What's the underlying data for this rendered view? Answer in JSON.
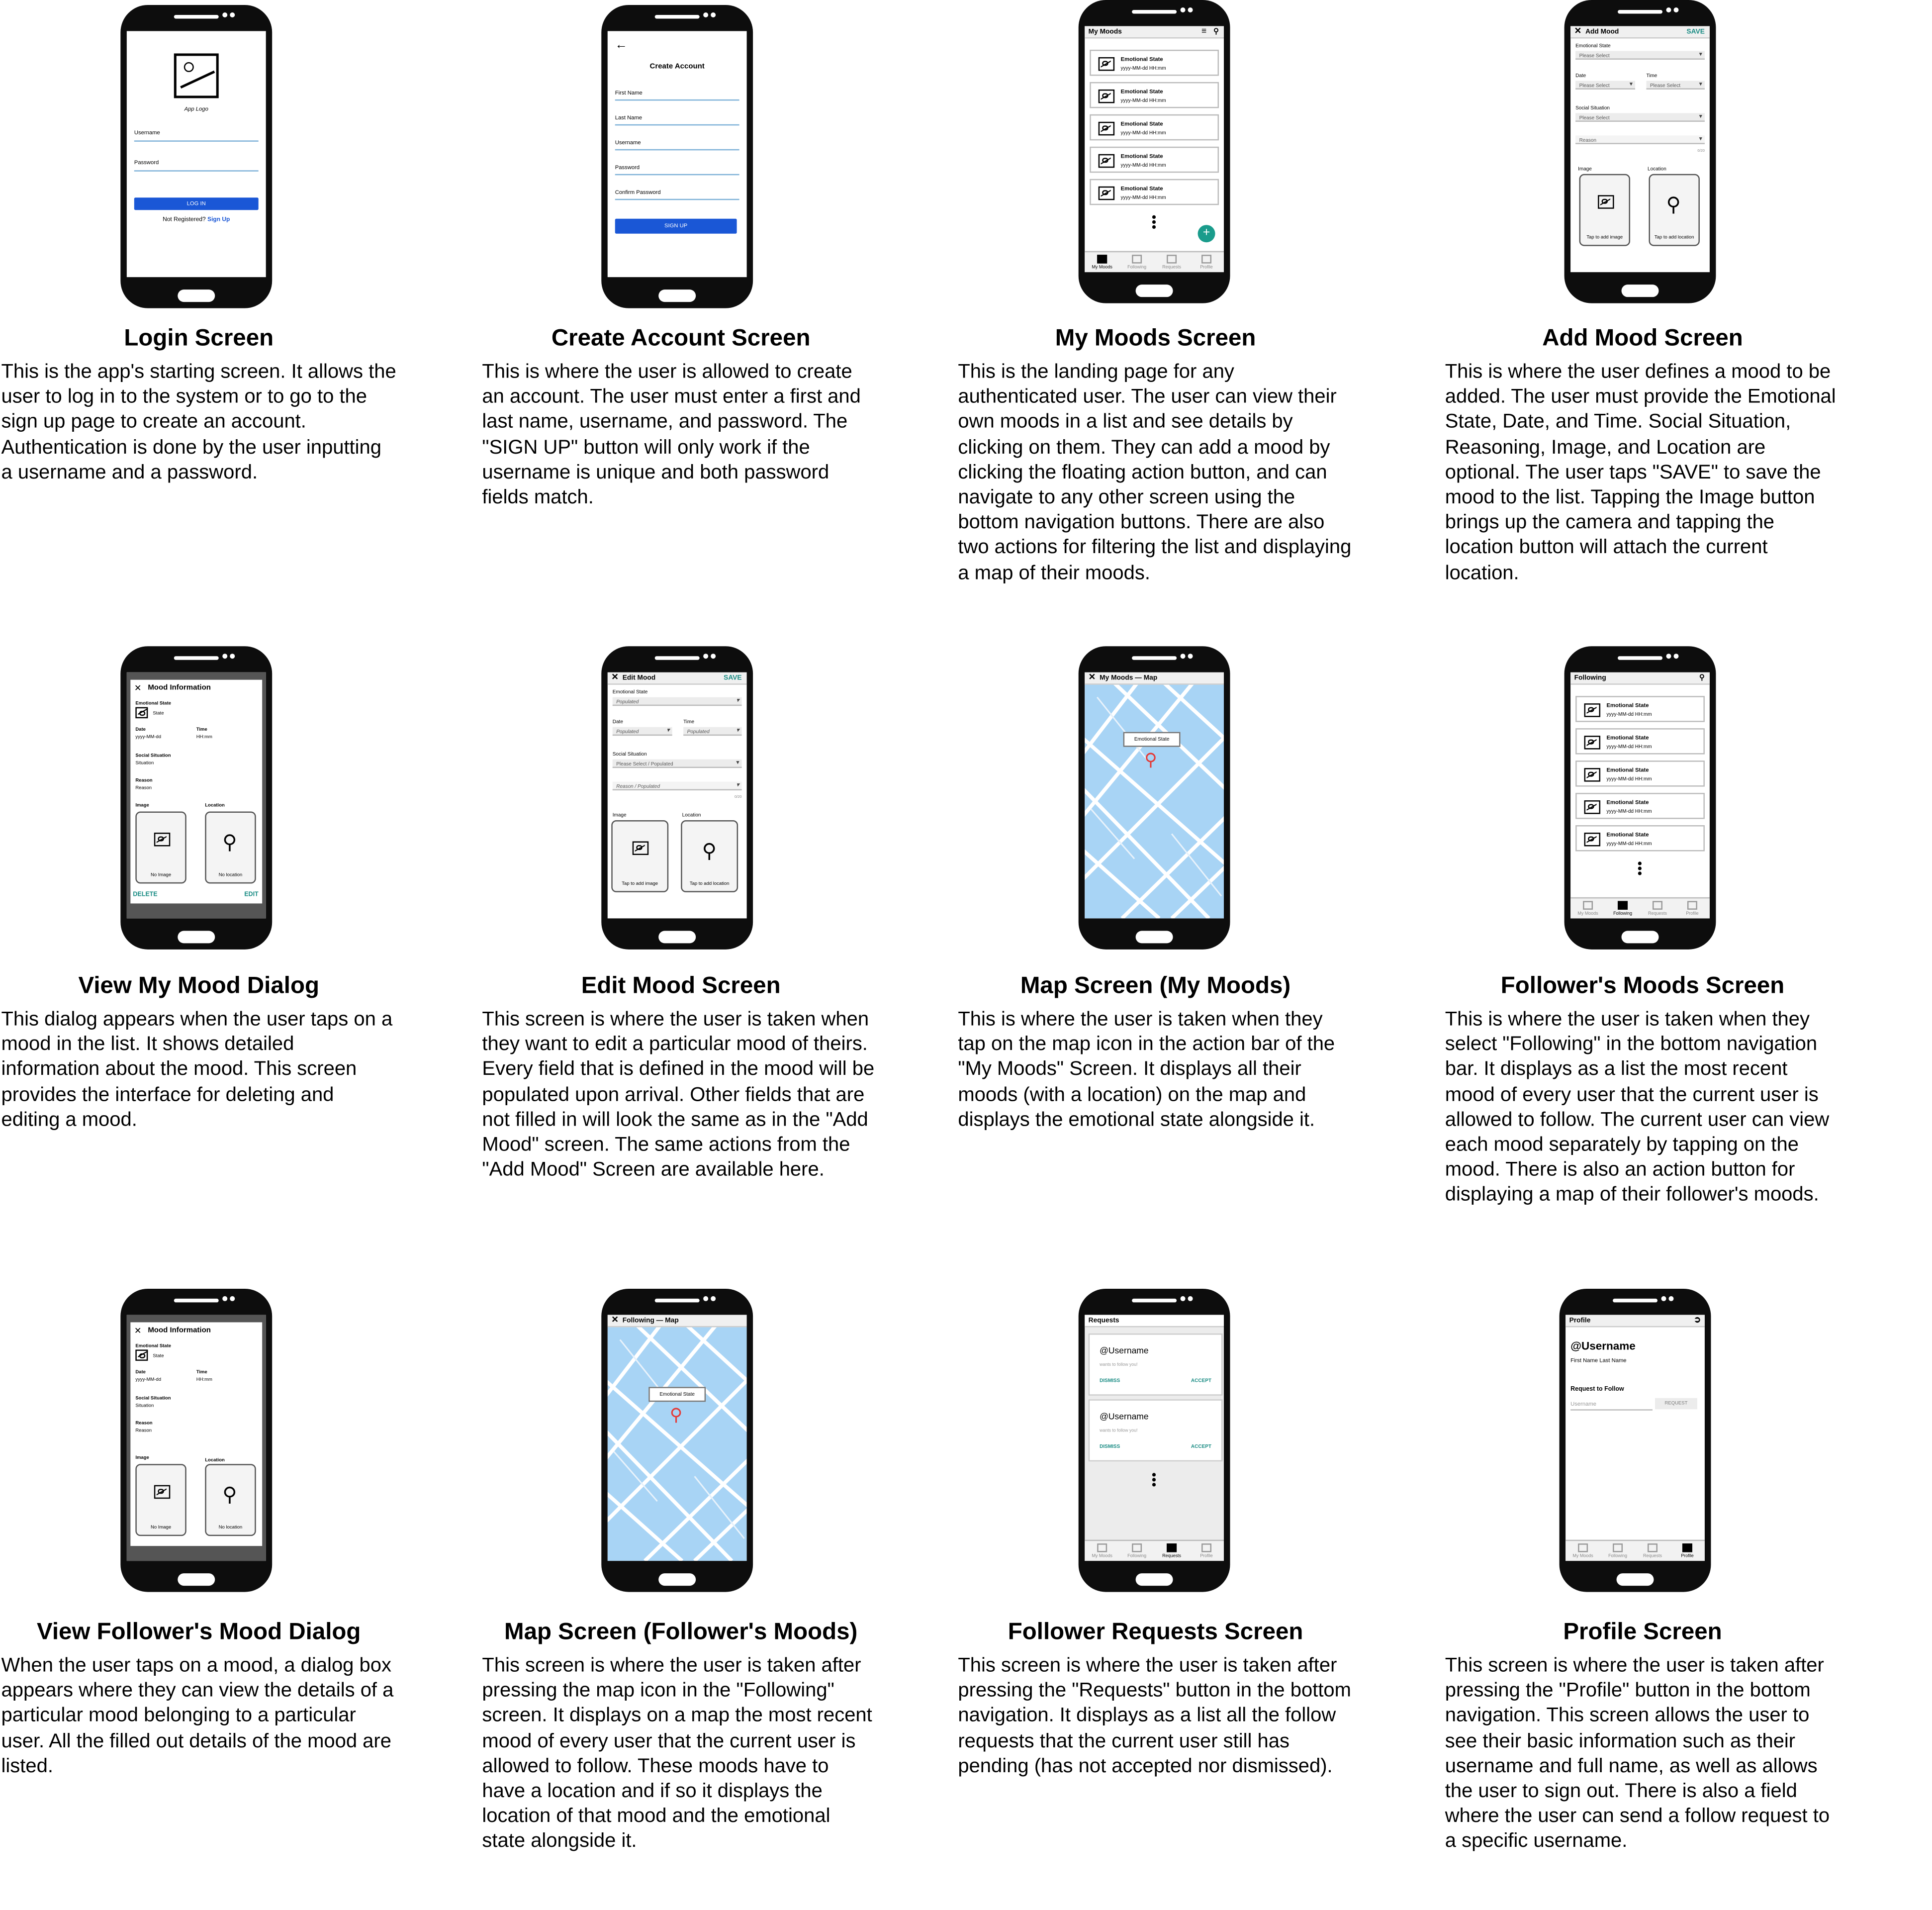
{
  "screens": [
    {
      "id": "login",
      "title": "Login Screen",
      "description": "This is the app's starting screen. It allows the user to log in to the system or to go to the sign up page to create an account. Authentication is done by the user inputting a username and a password.",
      "ui": {
        "logo_label": "App Logo",
        "username_label": "Username",
        "password_label": "Password",
        "login_button": "LOG IN",
        "not_registered": "Not Registered?",
        "signup_link": "Sign Up"
      }
    },
    {
      "id": "create-account",
      "title": "Create Account Screen",
      "description": "This is where the user is allowed to create an account. The user must enter a first and last name, username, and password. The \"SIGN UP\" button will only work if the username is unique and both password fields match.",
      "ui": {
        "heading": "Create Account",
        "first_name": "First Name",
        "last_name": "Last Name",
        "username": "Username",
        "password": "Password",
        "confirm_password": "Confirm Password",
        "signup_button": "SIGN UP"
      }
    },
    {
      "id": "my-moods",
      "title": "My Moods Screen",
      "description": "This is the landing page for any authenticated user. The user can view their own moods in a list and see details by clicking on them. They can add a mood by clicking the floating action button, and can navigate to any other screen using the bottom navigation buttons. There are also two actions for filtering the list and displaying a map of their moods.",
      "ui": {
        "bar_title": "My Moods",
        "item_title": "Emotional State",
        "item_sub": "yyyy-MM-dd   HH:mm",
        "fab": "+"
      }
    },
    {
      "id": "add-mood",
      "title": "Add Mood Screen",
      "description": "This is where the user defines a mood to be added. The user must provide the Emotional State, Date, and Time. Social Situation, Reasoning, Image, and Location are optional. The user taps \"SAVE\" to save the mood to the list. Tapping the Image button brings up the camera and tapping the location button will attach the current location.",
      "ui": {
        "bar_title": "Add Mood",
        "save": "SAVE",
        "emotional_state": "Emotional State",
        "please_select": "Please Select",
        "date": "Date",
        "time": "Time",
        "social_situation": "Social Situation",
        "reason": "Reason",
        "counter": "0/20",
        "image": "Image",
        "location": "Location",
        "tap_image": "Tap to add image",
        "tap_location": "Tap to add location"
      }
    },
    {
      "id": "view-my-mood",
      "title": "View My Mood Dialog",
      "description": "This dialog appears when the user taps on a mood in the list. It shows detailed information about the mood. This screen provides the interface for deleting and editing a mood.",
      "ui": {
        "dialog_title": "Mood Information",
        "emotional_state": "Emotional State",
        "state": "State",
        "date": "Date",
        "date_val": "yyyy-MM-dd",
        "time": "Time",
        "time_val": "HH:mm",
        "social_situation": "Social Situation",
        "situation": "Situation",
        "reason": "Reason",
        "reason_val": "Reason",
        "image": "Image",
        "location": "Location",
        "no_image": "No Image",
        "no_location": "No location",
        "delete": "DELETE",
        "edit": "EDIT"
      }
    },
    {
      "id": "edit-mood",
      "title": "Edit Mood Screen",
      "description": "This screen is where the user is taken when they want to edit a particular mood of theirs. Every field that is defined in the mood will be populated upon arrival. Other fields that are not filled in will look the same as in the \"Add Mood\" screen. The same actions from the \"Add Mood\" Screen are available here.",
      "ui": {
        "bar_title": "Edit Mood",
        "save": "SAVE",
        "emotional_state": "Emotional State",
        "populated": "Populated",
        "date": "Date",
        "time": "Time",
        "social_situation": "Social Situation",
        "select_populated": "Please Select / Populated",
        "reason_populated": "Reason / Populated",
        "counter": "0/20",
        "image": "Image",
        "location": "Location",
        "tap_image": "Tap to add image",
        "tap_location": "Tap to add location"
      }
    },
    {
      "id": "map-my-moods",
      "title": "Map Screen (My Moods)",
      "description": "This is where the user is taken when they tap on the map icon in the action bar of the \"My Moods\" Screen. It displays all their moods (with a location) on the map and displays the emotional state alongside it.",
      "ui": {
        "bar_title": "My Moods — Map",
        "callout": "Emotional State"
      }
    },
    {
      "id": "followers-moods",
      "title": "Follower's Moods Screen",
      "description": "This is where the user is taken when they select \"Following\" in the bottom navigation bar. It displays as a list the most recent mood of every user that the current user is allowed to follow. The current user can view each mood separately by tapping on the mood. There is also an action button for displaying a map of their follower's moods.",
      "ui": {
        "bar_title": "Following",
        "item_title": "Emotional State",
        "item_sub": "yyyy-MM-dd   HH:mm"
      }
    },
    {
      "id": "view-follower-mood",
      "title": "View Follower's Mood Dialog",
      "description": "When the user taps on a mood, a dialog box appears where they can view the details of a particular mood belonging to a particular user. All the filled out details of the mood are listed.",
      "ui": {
        "dialog_title": "Mood Information",
        "emotional_state": "Emotional State",
        "state": "State",
        "date": "Date",
        "date_val": "yyyy-MM-dd",
        "time": "Time",
        "time_val": "HH:mm",
        "social_situation": "Social Situation",
        "situation": "Situation",
        "reason": "Reason",
        "reason_val": "Reason",
        "image": "Image",
        "location": "Location",
        "no_image": "No Image",
        "no_location": "No location"
      }
    },
    {
      "id": "map-following",
      "title": "Map Screen (Follower's Moods)",
      "description": "This screen is where the user is taken after pressing the map icon in the \"Following\" screen. It displays on a map the most recent mood of every user that the current user is allowed to follow. These moods have to have a location and if so it displays the location of that mood and the emotional state alongside it.",
      "ui": {
        "bar_title": "Following — Map",
        "callout": "Emotional State"
      }
    },
    {
      "id": "requests",
      "title": "Follower Requests Screen",
      "description": "This screen is where the user is taken after pressing the \"Requests\" button in the bottom navigation. It displays as a list all the follow requests that the current user still has pending (has not accepted nor dismissed).",
      "ui": {
        "bar_title": "Requests",
        "username": "@Username",
        "wants": "wants to follow you!",
        "dismiss": "DISMISS",
        "accept": "ACCEPT"
      }
    },
    {
      "id": "profile",
      "title": "Profile Screen",
      "description": "This screen is where the user is taken after pressing the \"Profile\" button in the bottom navigation. This screen allows the user to see their basic information such as their username and full name, as well as allows the user to sign out. There is also a field where the user can send a follow request to a specific username.",
      "ui": {
        "bar_title": "Profile",
        "username": "@Username",
        "full_name": "First Name   Last Name",
        "request_heading": "Request to Follow",
        "username_placeholder": "Username",
        "request_button": "REQUEST"
      }
    }
  ],
  "nav": [
    "My Moods",
    "Following",
    "Requests",
    "Profile"
  ],
  "colors": {
    "accent_blue": "#1a57d6",
    "teal": "#1a8c84",
    "map_water": "#a8d4f5",
    "pin": "#e53935"
  }
}
